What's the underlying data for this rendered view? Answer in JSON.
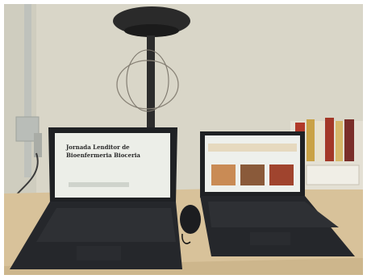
{
  "photo": {
    "subject": "desk-with-lamp-and-two-laptops",
    "colors": {
      "wall": "#d9d6c8",
      "desk": "#d8c29a",
      "laptop": "#1f2124",
      "screen": "#eceee8",
      "lamp": "#2a2a2a"
    }
  },
  "left_screen": {
    "heading_line1": "Jornada Lenditor de",
    "heading_line2": "Bioenfermeria Bioceria"
  },
  "right_screen": {
    "header_text": "",
    "thumbnails": [
      "thumb-1",
      "thumb-2",
      "thumb-3"
    ]
  }
}
